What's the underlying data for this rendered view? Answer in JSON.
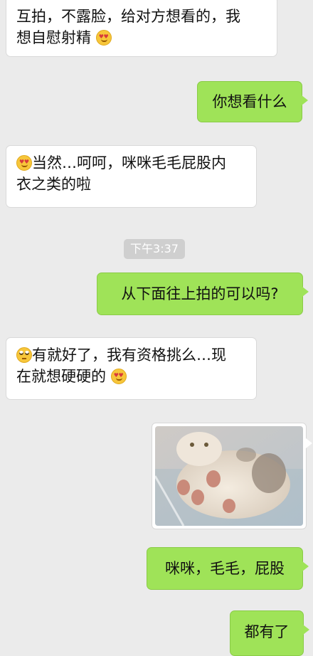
{
  "chat": {
    "messages": [
      {
        "side": "in",
        "text": "互拍，不露脸，给对方想看的，我想自慰射精",
        "emoji": "heart-eyes"
      },
      {
        "side": "out",
        "text": "你想看什么"
      },
      {
        "side": "in",
        "text": "当然…呵呵，咪咪毛毛屁股内衣之类的啦",
        "emoji_leading": "heart-eyes"
      },
      {
        "side": "out",
        "text": "从下面往上拍的可以吗?"
      },
      {
        "side": "in",
        "text_a": "有就好了，我有资格挑么…现在就想硬硬的",
        "emoji_leading": "rolling-eyes",
        "emoji": "heart-eyes"
      },
      {
        "side": "out",
        "type": "image",
        "subject": "cat-photo"
      },
      {
        "side": "out",
        "text": "咪咪，毛毛，屁股"
      },
      {
        "side": "out",
        "text": "都有了"
      }
    ],
    "timestamp": "下午3:37"
  },
  "m1": {
    "line1": "互拍，不露脸，给对方想看的，我",
    "line2": "想自慰射精"
  },
  "m2": {
    "text": "你想看什么"
  },
  "m3": {
    "line1": "当然…呵呵，咪咪毛毛屁股内",
    "line2": "衣之类的啦"
  },
  "m4": {
    "text": "从下面往上拍的可以吗?"
  },
  "m5": {
    "line1": "有就好了，我有资格挑么…现",
    "line2": "在就想硬硬的"
  },
  "m7": {
    "text": "咪咪，毛毛，屁股"
  },
  "m8": {
    "text": "都有了"
  },
  "colors": {
    "background": "#ebebeb",
    "outgoing": "#9fe358",
    "incoming": "#ffffff",
    "timestamp_pill": "#cfcfcf"
  }
}
